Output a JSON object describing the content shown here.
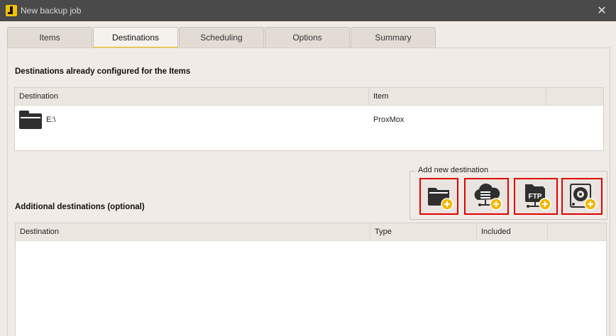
{
  "window": {
    "title": "New backup job",
    "close_glyph": "✕"
  },
  "tabs": [
    {
      "label": "Items",
      "active": false
    },
    {
      "label": "Destinations",
      "active": true
    },
    {
      "label": "Scheduling",
      "active": false
    },
    {
      "label": "Options",
      "active": false
    },
    {
      "label": "Summary",
      "active": false
    }
  ],
  "configured": {
    "title": "Destinations already configured for the Items",
    "columns": [
      "Destination",
      "Item"
    ],
    "rows": [
      {
        "destination": "E:\\",
        "item": "ProxMox",
        "icon": "folder-icon"
      }
    ]
  },
  "add_new": {
    "label": "Add new destination",
    "buttons": [
      {
        "name": "add-local-folder-destination",
        "icon": "folder-plus-icon"
      },
      {
        "name": "add-cloud-destination",
        "icon": "cloud-plus-icon"
      },
      {
        "name": "add-ftp-destination",
        "icon": "ftp-plus-icon",
        "text": "FTP"
      },
      {
        "name": "add-disk-destination",
        "icon": "disk-plus-icon"
      }
    ],
    "accent": "#f2b705",
    "highlight": "#e00000"
  },
  "additional": {
    "title": "Additional destinations (optional)",
    "columns": [
      "Destination",
      "Type",
      "Included"
    ],
    "rows": []
  }
}
